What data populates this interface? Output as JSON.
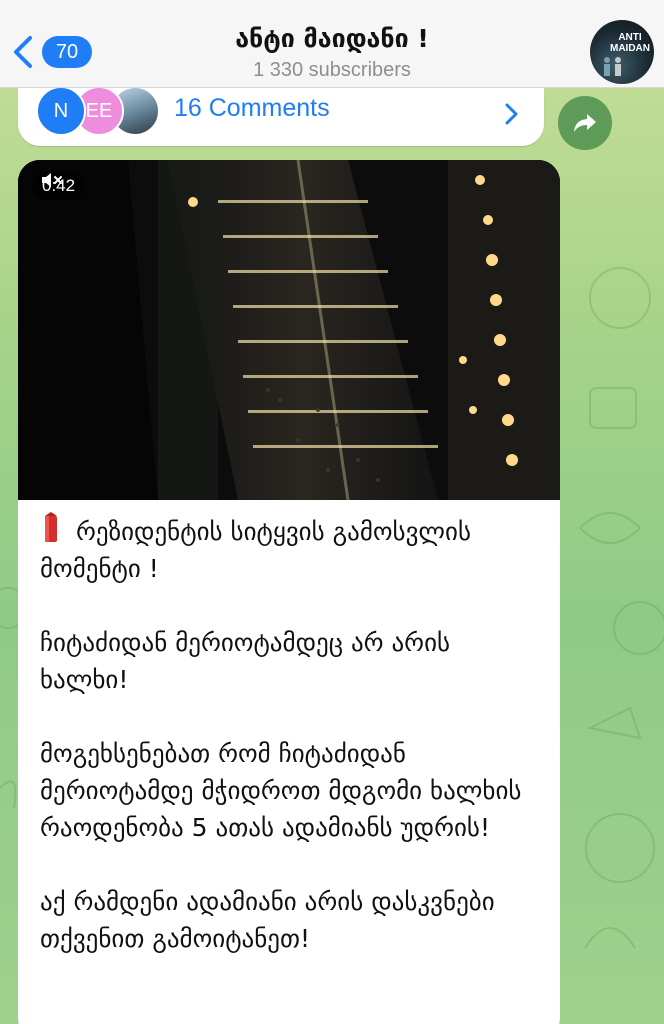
{
  "header": {
    "back_count": "70",
    "title": "ანტი მაიდანი !",
    "subtitle": "1 330 subscribers",
    "avatar_text_line1": "ANTI",
    "avatar_text_line2": "MAIDAN"
  },
  "comments": {
    "avatar_1_initial": "N",
    "avatar_2_initial": "EE",
    "label": "16 Comments"
  },
  "video": {
    "duration": "0:42"
  },
  "message": {
    "paragraphs": [
      "რეზიდენტის სიტყვის გამოსვლის მომენტი !",
      "ჩიტაძიდან მერიოტამდეც არ არის ხალხი!",
      "მოგეხსენებათ რომ ჩიტაძიდან მერიოტამდე მჭიდროთ მდგომი ხალხის რაოდენობა 5 ათას ადამიანს უდრის!",
      "აქ რამდენი ადამიანი არის დასკვნები თქვენით გამოიტანეთ!"
    ]
  },
  "colors": {
    "accent": "#1f7ef5",
    "share_button": "#5e9a58",
    "alert_icon": "#d32f2f"
  }
}
